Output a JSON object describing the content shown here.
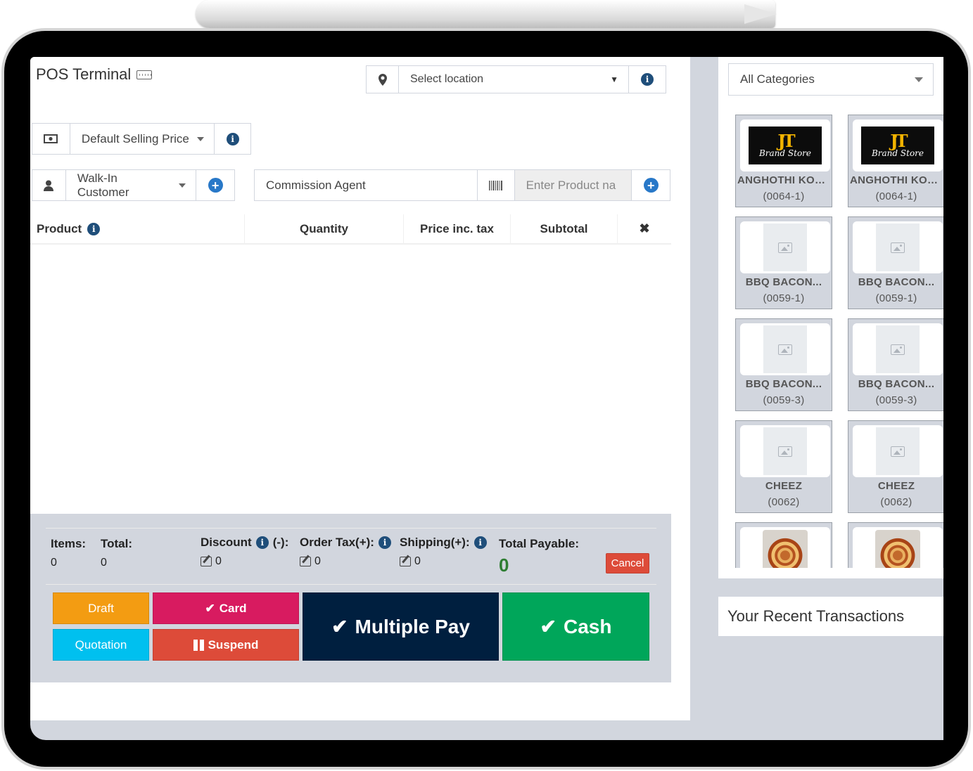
{
  "header": {
    "title": "POS Terminal"
  },
  "location": {
    "placeholder": "Select location"
  },
  "price_group": {
    "selected": "Default Selling Price"
  },
  "customer": {
    "selected": "Walk-In Customer"
  },
  "commission": {
    "placeholder": "Commission Agent"
  },
  "product_search": {
    "placeholder": "Enter Product na"
  },
  "table": {
    "columns": [
      "Product",
      "Quantity",
      "Price inc. tax",
      "Subtotal",
      "✖"
    ]
  },
  "totals": {
    "items_label": "Items:",
    "items_value": "0",
    "total_label": "Total:",
    "total_value": "0",
    "discount_label": "Discount",
    "discount_suffix": "(-):",
    "discount_value": "0",
    "order_tax_label": "Order Tax(+):",
    "order_tax_value": "0",
    "shipping_label": "Shipping(+):",
    "shipping_value": "0",
    "total_payable_label": "Total Payable:",
    "total_payable_value": "0",
    "cancel_label": "Cancel"
  },
  "actions": {
    "draft": "Draft",
    "quotation": "Quotation",
    "card": "Card",
    "suspend": "Suspend",
    "multiple_pay": "Multiple Pay",
    "cash": "Cash"
  },
  "categories": {
    "selected": "All Categories"
  },
  "products": [
    {
      "name": "ANGHOTHI KON...",
      "sku": "(0064-1)",
      "image": "brand-logo"
    },
    {
      "name": "ANGHOTHI KON...",
      "sku": "(0064-1)",
      "image": "brand-logo"
    },
    {
      "name": "BBQ BACON...",
      "sku": "(0059-1)",
      "image": "placeholder"
    },
    {
      "name": "BBQ BACON...",
      "sku": "(0059-1)",
      "image": "placeholder"
    },
    {
      "name": "BBQ BACON...",
      "sku": "(0059-3)",
      "image": "placeholder"
    },
    {
      "name": "BBQ BACON...",
      "sku": "(0059-3)",
      "image": "placeholder"
    },
    {
      "name": "CHEEZ",
      "sku": "(0062)",
      "image": "placeholder"
    },
    {
      "name": "CHEEZ",
      "sku": "(0062)",
      "image": "placeholder"
    },
    {
      "name": "",
      "sku": "",
      "image": "pizza-photo"
    },
    {
      "name": "",
      "sku": "",
      "image": "pizza-photo"
    }
  ],
  "brand_logo": {
    "initials": "JT",
    "text": "Brand Store"
  },
  "recent": {
    "title": "Your Recent Transactions"
  },
  "colors": {
    "draft": "#f39c12",
    "quotation": "#00c0ef",
    "card": "#d81b60",
    "suspend": "#dd4b39",
    "multiple_pay": "#001f3f",
    "cash": "#00a65a"
  }
}
